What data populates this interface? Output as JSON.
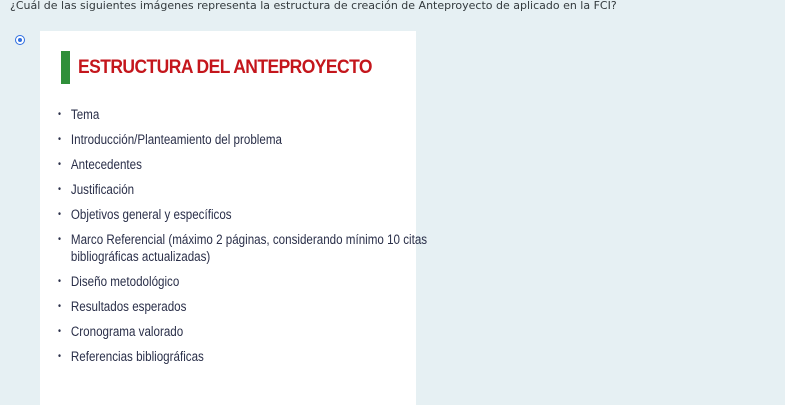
{
  "question": {
    "text": "¿Cuál de las siguientes imágenes representa la estructura de creación de Anteproyecto de aplicado en la FCI?"
  },
  "option": {
    "selected": true,
    "image": {
      "title": "ESTRUCTURA DEL ANTEPROYECTO",
      "bullet": "•",
      "items": [
        {
          "line1": "Tema",
          "line2": ""
        },
        {
          "line1": "Introducción/Planteamiento del problema",
          "line2": ""
        },
        {
          "line1": "Antecedentes",
          "line2": ""
        },
        {
          "line1": "Justificación",
          "line2": ""
        },
        {
          "line1": "Objetivos general y específicos",
          "line2": ""
        },
        {
          "line1": "Marco Referencial (máximo 2 páginas, considerando mínimo 10 citas",
          "line2": "bibliográficas actualizadas)"
        },
        {
          "line1": "Diseño metodológico",
          "line2": ""
        },
        {
          "line1": "Resultados esperados",
          "line2": ""
        },
        {
          "line1": "Cronograma valorado",
          "line2": ""
        },
        {
          "line1": "Referencias bibliográficas",
          "line2": ""
        }
      ]
    }
  },
  "colors": {
    "background": "#e6f0f3",
    "radio_accent": "#2f6fe0",
    "title_red": "#c4161c",
    "title_bar_green": "#2f8f3a",
    "list_text": "#2a2f49"
  }
}
